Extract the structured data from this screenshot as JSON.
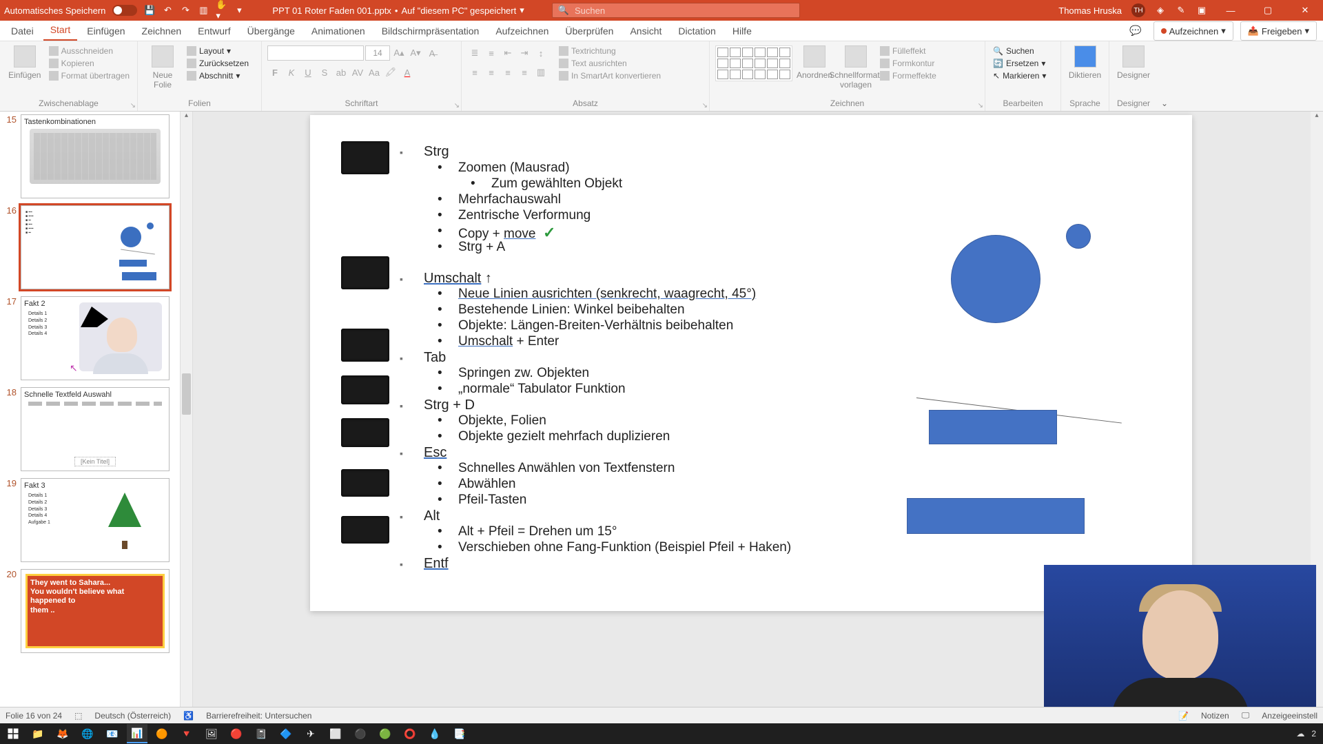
{
  "titlebar": {
    "autosave": "Automatisches Speichern",
    "filename": "PPT 01 Roter Faden 001.pptx",
    "saved_note": "Auf \"diesem PC\" gespeichert",
    "search_placeholder": "Suchen",
    "user_name": "Thomas Hruska",
    "user_initials": "TH"
  },
  "tabs": {
    "datei": "Datei",
    "start": "Start",
    "einfuegen": "Einfügen",
    "zeichnen": "Zeichnen",
    "entwurf": "Entwurf",
    "uebergaenge": "Übergänge",
    "animationen": "Animationen",
    "bildschirm": "Bildschirmpräsentation",
    "aufzeichnen_tab": "Aufzeichnen",
    "ueberpruefen": "Überprüfen",
    "ansicht": "Ansicht",
    "dictation": "Dictation",
    "hilfe": "Hilfe",
    "aufzeichnen_btn": "Aufzeichnen",
    "freigeben": "Freigeben"
  },
  "ribbon": {
    "zwischenablage": {
      "label": "Zwischenablage",
      "einfuegen": "Einfügen",
      "ausschneiden": "Ausschneiden",
      "kopieren": "Kopieren",
      "format": "Format übertragen"
    },
    "folien": {
      "label": "Folien",
      "neue": "Neue\nFolie",
      "layout": "Layout",
      "zuruecksetzen": "Zurücksetzen",
      "abschnitt": "Abschnitt"
    },
    "schriftart": {
      "label": "Schriftart",
      "size": "14"
    },
    "absatz": {
      "label": "Absatz",
      "textrichtung": "Textrichtung",
      "textausrichten": "Text ausrichten",
      "smartart": "In SmartArt konvertieren"
    },
    "zeichnen": {
      "label": "Zeichnen",
      "anordnen": "Anordnen",
      "schnell": "Schnellformat-\nvorlagen",
      "fuell": "Fülleffekt",
      "kontur": "Formkontur",
      "effekte": "Formeffekte"
    },
    "bearbeiten": {
      "label": "Bearbeiten",
      "suchen": "Suchen",
      "ersetzen": "Ersetzen",
      "markieren": "Markieren"
    },
    "sprache": {
      "label": "Sprache",
      "diktieren": "Diktieren"
    },
    "designer": {
      "label": "Designer",
      "designer": "Designer"
    }
  },
  "thumbs": {
    "15": {
      "num": "15",
      "title": "Tastenkombinationen"
    },
    "16": {
      "num": "16"
    },
    "17": {
      "num": "17",
      "title": "Fakt 2",
      "d1": "Details 1",
      "d2": "Details 2",
      "d3": "Details 3",
      "d4": "Details 4"
    },
    "18": {
      "num": "18",
      "title": "Schnelle Textfeld Auswahl",
      "notitle": "[Kein Titel]"
    },
    "19": {
      "num": "19",
      "title": "Fakt 3",
      "d1": "Details 1",
      "d2": "Details 2",
      "d3": "Details 3",
      "d4": "Details 4",
      "d5": "Aufgabe 1"
    },
    "20": {
      "num": "20",
      "sahara": "They went to Sahara...\nYou wouldn't believe what\nhappened to\nthem .."
    }
  },
  "slide": {
    "strg": "Strg",
    "strg_zoom": "Zoomen (Mausrad)",
    "strg_zumobj": "Zum gewählten Objekt",
    "strg_mehr": "Mehrfachauswahl",
    "strg_zentr": "Zentrische Verformung",
    "strg_copy": "Copy + ",
    "strg_move": "move",
    "strg_a": "Strg + A",
    "umschalt": "Umschalt",
    "um_arrow": "↑",
    "um_neue": "Neue Linien ausrichten (senkrecht, waagrecht, 45°)",
    "um_best": "Bestehende Linien: Winkel beibehalten",
    "um_obj": "Objekte: Längen-Breiten-Verhältnis beibehalten",
    "um_enter_a": "Umschalt",
    "um_enter_b": " + Enter",
    "tab": "Tab",
    "tab_spring": "Springen zw. Objekten",
    "tab_norm": "„normale“ Tabulator Funktion",
    "strgd": "Strg + D",
    "strgd_obj": "Objekte, Folien",
    "strgd_dup": "Objekte gezielt mehrfach duplizieren",
    "esc": "Esc",
    "esc_schnell": "Schnelles Anwählen von Textfenstern",
    "esc_abw": "Abwählen",
    "esc_pfeil": "Pfeil-Tasten",
    "alt": "Alt",
    "alt_dreh": "Alt + Pfeil = Drehen um 15°",
    "alt_versch": "Verschieben ohne Fang-Funktion (Beispiel Pfeil + Haken)",
    "entf": "Entf"
  },
  "statusbar": {
    "folie": "Folie 16 von 24",
    "lang": "Deutsch (Österreich)",
    "barriere": "Barrierefreiheit: Untersuchen",
    "notizen": "Notizen",
    "anzeige": "Anzeigeeinstell"
  },
  "tray": {
    "temp": "2"
  }
}
